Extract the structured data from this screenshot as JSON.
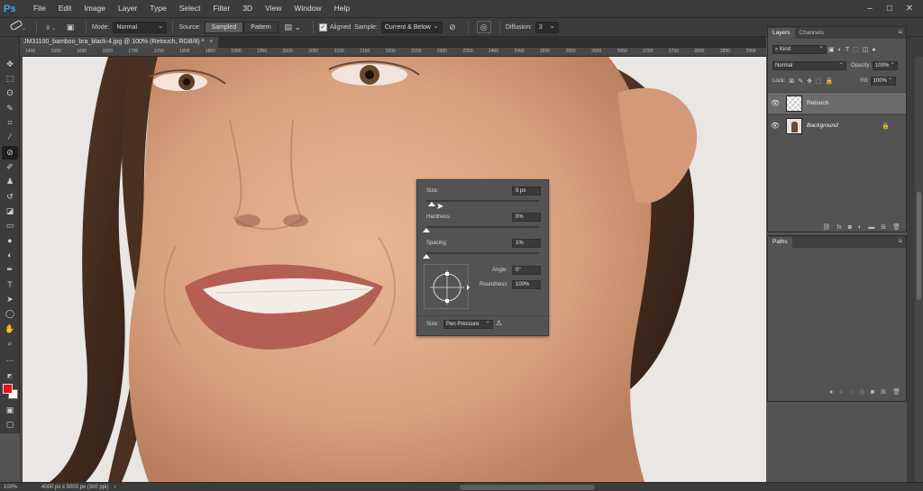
{
  "app": {
    "logo": "Ps",
    "menu": [
      "File",
      "Edit",
      "Image",
      "Layer",
      "Type",
      "Select",
      "Filter",
      "3D",
      "View",
      "Window",
      "Help"
    ],
    "window_controls": [
      "–",
      "□",
      "✕"
    ]
  },
  "options_bar": {
    "brush_size": "9",
    "mode_label": "Mode:",
    "mode_value": "Normal",
    "source_label": "Source:",
    "source_sampled": "Sampled",
    "source_pattern": "Pattern",
    "aligned_label": "Aligned",
    "sample_label": "Sample:",
    "sample_value": "Current & Below",
    "diffusion_label": "Diffusion:",
    "diffusion_value": "3"
  },
  "document": {
    "tab_title": "JM31100_bamboo_bra_black-4.jpg @ 100% (Retouch, RGB/8) *",
    "tab_close": "×"
  },
  "ruler_ticks": [
    "1400",
    "1500",
    "1600",
    "1650",
    "1700",
    "1750",
    "1800",
    "1850",
    "1900",
    "1950",
    "2000",
    "2050",
    "2100",
    "2150",
    "2200",
    "2250",
    "2300",
    "2350",
    "2400",
    "2450",
    "2500",
    "2550",
    "2600",
    "2650",
    "2700",
    "2750",
    "2800",
    "2850",
    "2900"
  ],
  "brush_popup": {
    "size_label": "Size:",
    "size_value": "9 px",
    "hardness_label": "Hardness:",
    "hardness_value": "0%",
    "spacing_label": "Spacing:",
    "spacing_value": "1%",
    "angle_label": "Angle:",
    "angle_value": "0°",
    "roundness_label": "Roundness:",
    "roundness_value": "100%",
    "size_control_label": "Size:",
    "size_control_value": "Pen Pressure"
  },
  "layers_panel": {
    "tab_layers": "Layers",
    "tab_channels": "Channels",
    "filter_kind": "Kind",
    "blend_mode": "Normal",
    "opacity_label": "Opacity:",
    "opacity_value": "100%",
    "lock_label": "Lock:",
    "fill_label": "Fill:",
    "fill_value": "100%",
    "layers": [
      {
        "name": "Retouch",
        "visible": true,
        "selected": true
      },
      {
        "name": "Background",
        "visible": true,
        "locked": true
      }
    ]
  },
  "paths_panel": {
    "title": "Paths"
  },
  "status": {
    "zoom": "100%",
    "doc_info": "4000 px x 5000 px (300 ppi)"
  },
  "colors": {
    "foreground": "#e51515",
    "background": "#ffffff",
    "ui_dark": "#3c3c3c",
    "panel": "#535353"
  }
}
